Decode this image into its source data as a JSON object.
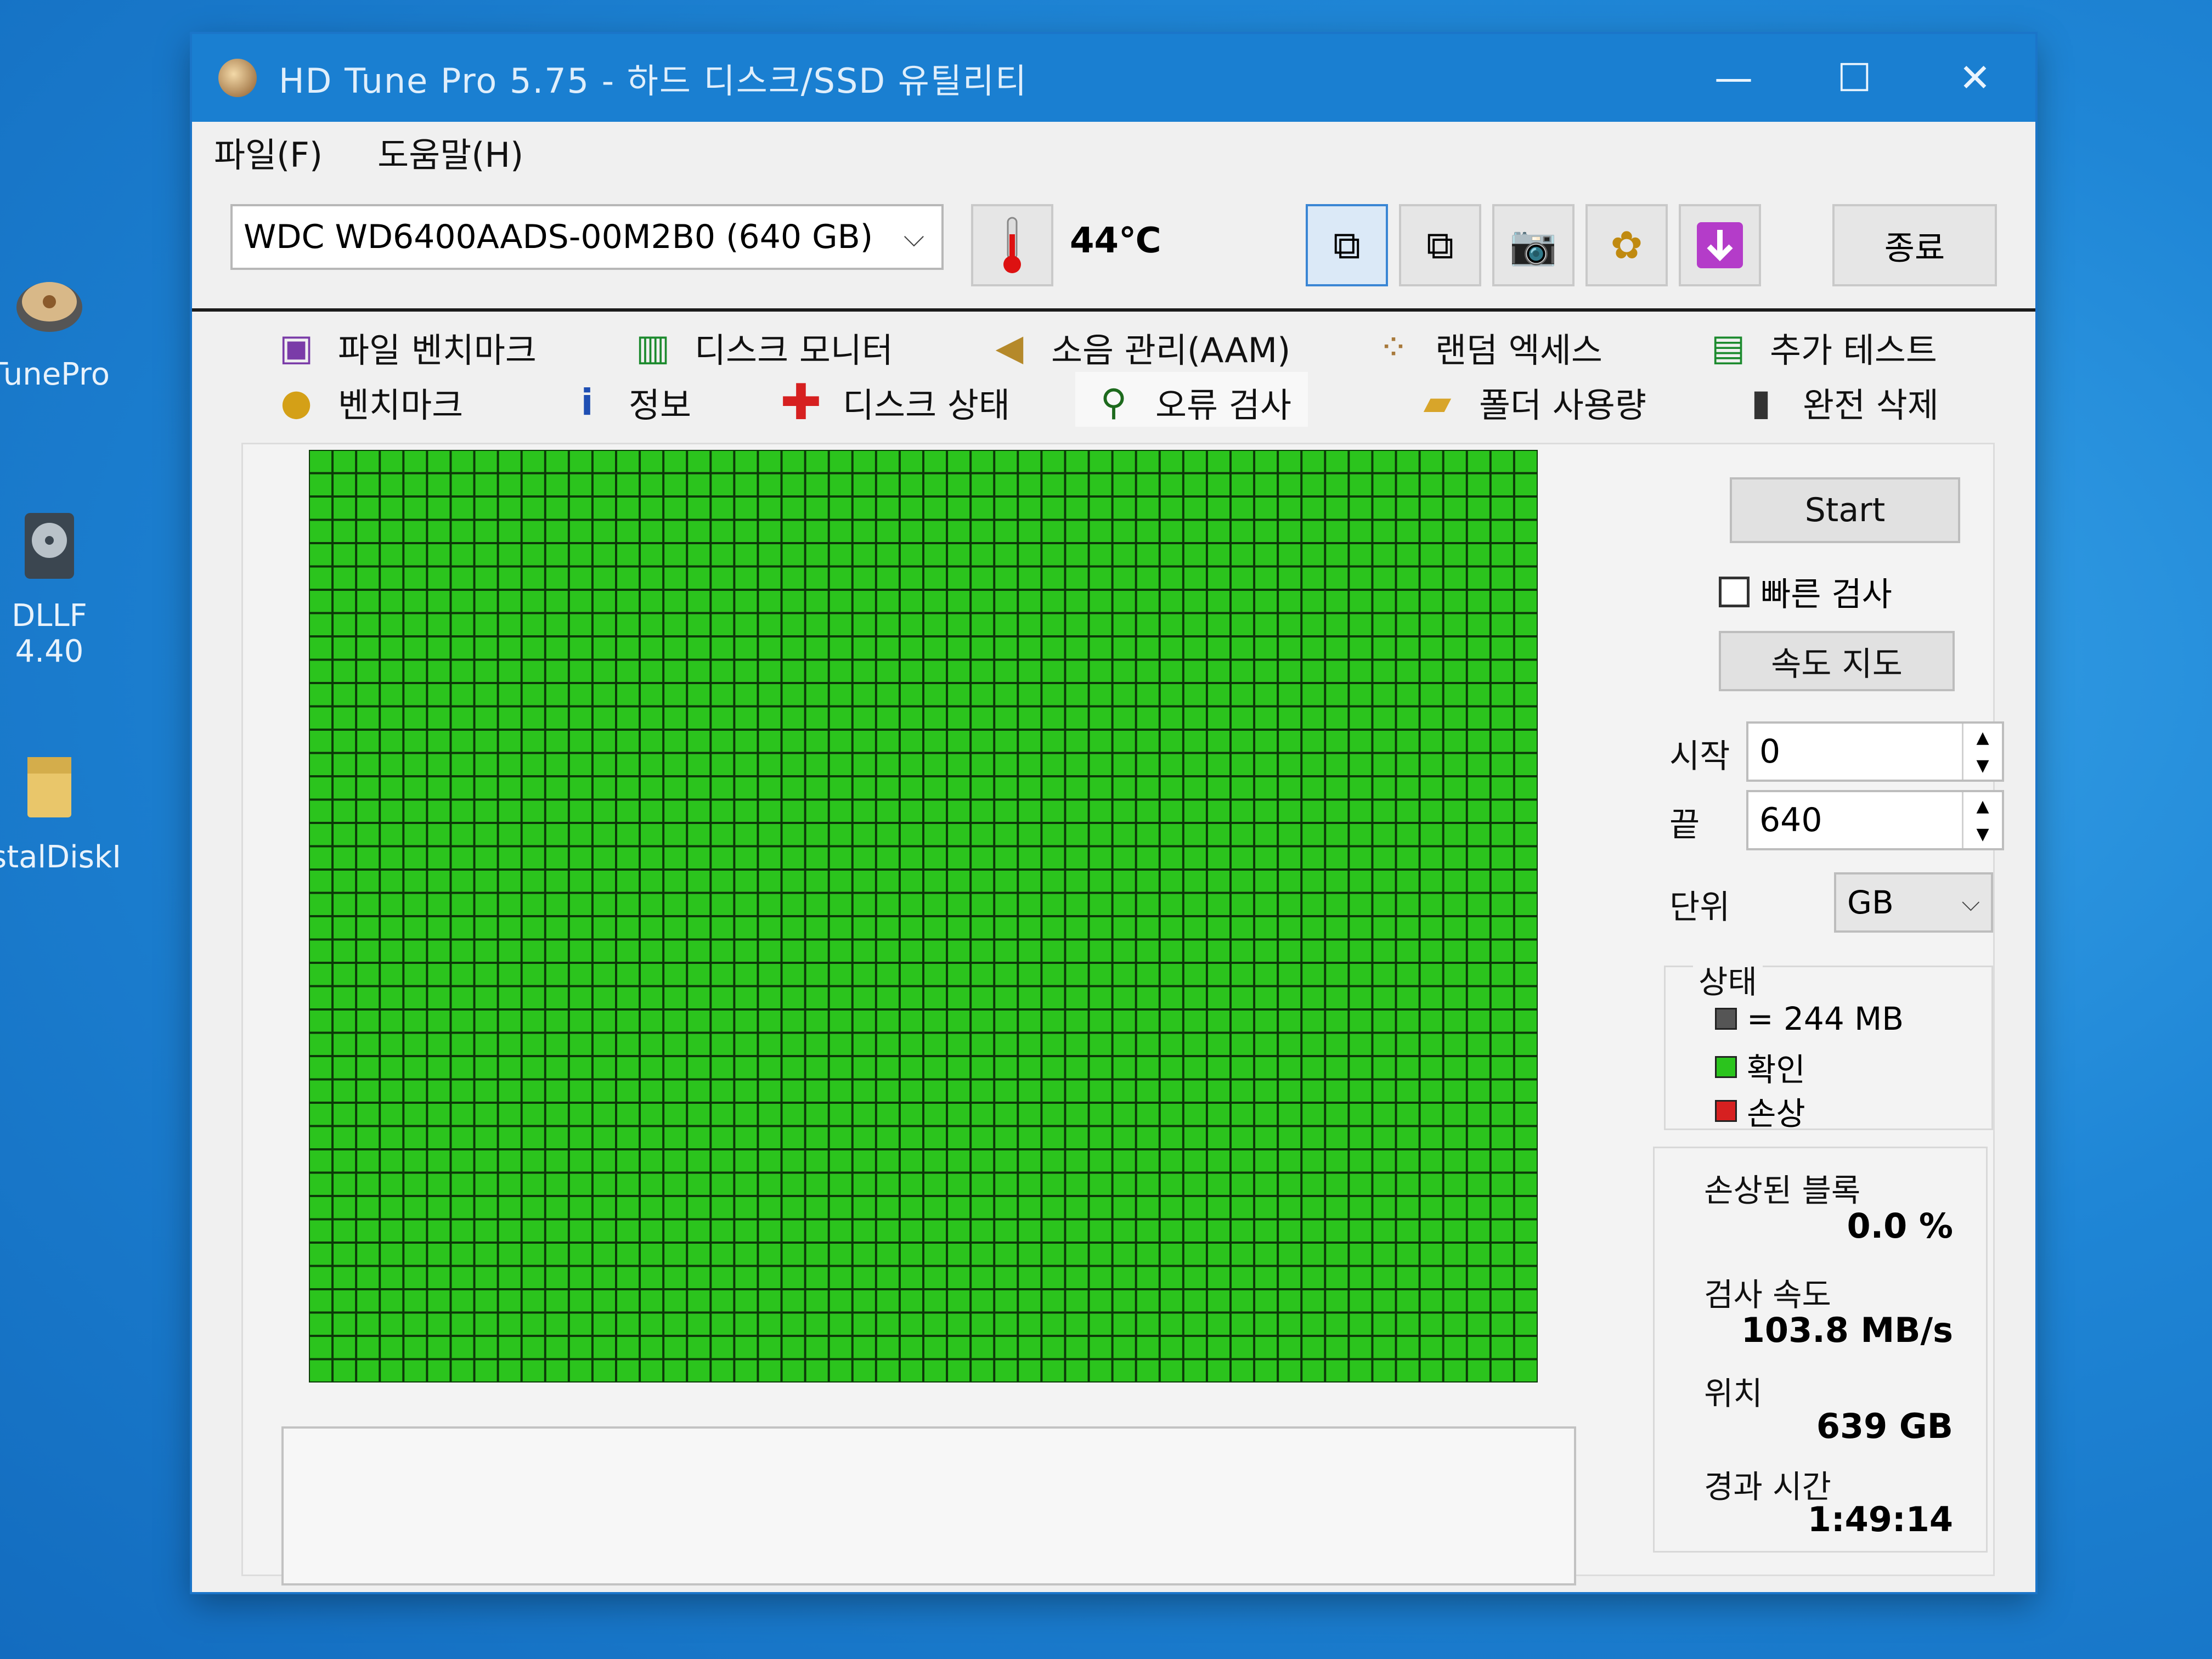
{
  "desktop": {
    "icons": [
      {
        "label": "TunePro"
      },
      {
        "label": "DLLF 4.40"
      },
      {
        "label": "rstalDiskI"
      }
    ]
  },
  "window": {
    "title": "HD Tune Pro 5.75 - 하드 디스크/SSD 유틸리티",
    "controls": {
      "minimize": "—",
      "maximize": "☐",
      "close": "✕"
    }
  },
  "menu": {
    "file": "파일(F)",
    "help": "도움말(H)"
  },
  "toolbar": {
    "drive": "WDC WD6400AADS-00M2B0 (640 GB)",
    "temperature": "44℃",
    "quit_label": "종료"
  },
  "tabs": {
    "row1": [
      {
        "label": "파일 벤치마크",
        "icon": "file-benchmark-icon"
      },
      {
        "label": "디스크 모니터",
        "icon": "disk-monitor-icon"
      },
      {
        "label": "소음 관리(AAM)",
        "icon": "speaker-icon"
      },
      {
        "label": "랜덤 엑세스",
        "icon": "random-access-icon"
      },
      {
        "label": "추가 테스트",
        "icon": "extra-tests-icon"
      }
    ],
    "row2": [
      {
        "label": "벤치마크",
        "icon": "bulb-icon"
      },
      {
        "label": "정보",
        "icon": "info-icon"
      },
      {
        "label": "디스크 상태",
        "icon": "health-cross-icon"
      },
      {
        "label": "오류 검사",
        "icon": "magnifier-icon"
      },
      {
        "label": "폴더 사용량",
        "icon": "folder-icon"
      },
      {
        "label": "완전 삭제",
        "icon": "trash-icon"
      }
    ],
    "active": "오류 검사"
  },
  "scan": {
    "grid_columns": 52,
    "grid_rows": 40,
    "block_color": "#2bc41d",
    "line_color": "#0c3a08"
  },
  "controls": {
    "start_label": "Start",
    "quick_scan_label": "빠른 검사",
    "quick_scan_checked": false,
    "speed_map_label": "속도 지도",
    "start_field_label": "시작",
    "start_value": "0",
    "end_field_label": "끝",
    "end_value": "640",
    "unit_label": "단위",
    "unit_value": "GB"
  },
  "legend": {
    "title": "상태",
    "items": [
      {
        "label": "= 244 MB",
        "color": "#555555"
      },
      {
        "label": "확인",
        "color": "#2bc41d"
      },
      {
        "label": "손상",
        "color": "#d62020"
      }
    ]
  },
  "stats": {
    "damaged_label": "손상된 블록",
    "damaged_value": "0.0 %",
    "speed_label": "검사 속도",
    "speed_value": "103.8 MB/s",
    "position_label": "위치",
    "position_value": "639 GB",
    "elapsed_label": "경과 시간",
    "elapsed_value": "1:49:14"
  }
}
